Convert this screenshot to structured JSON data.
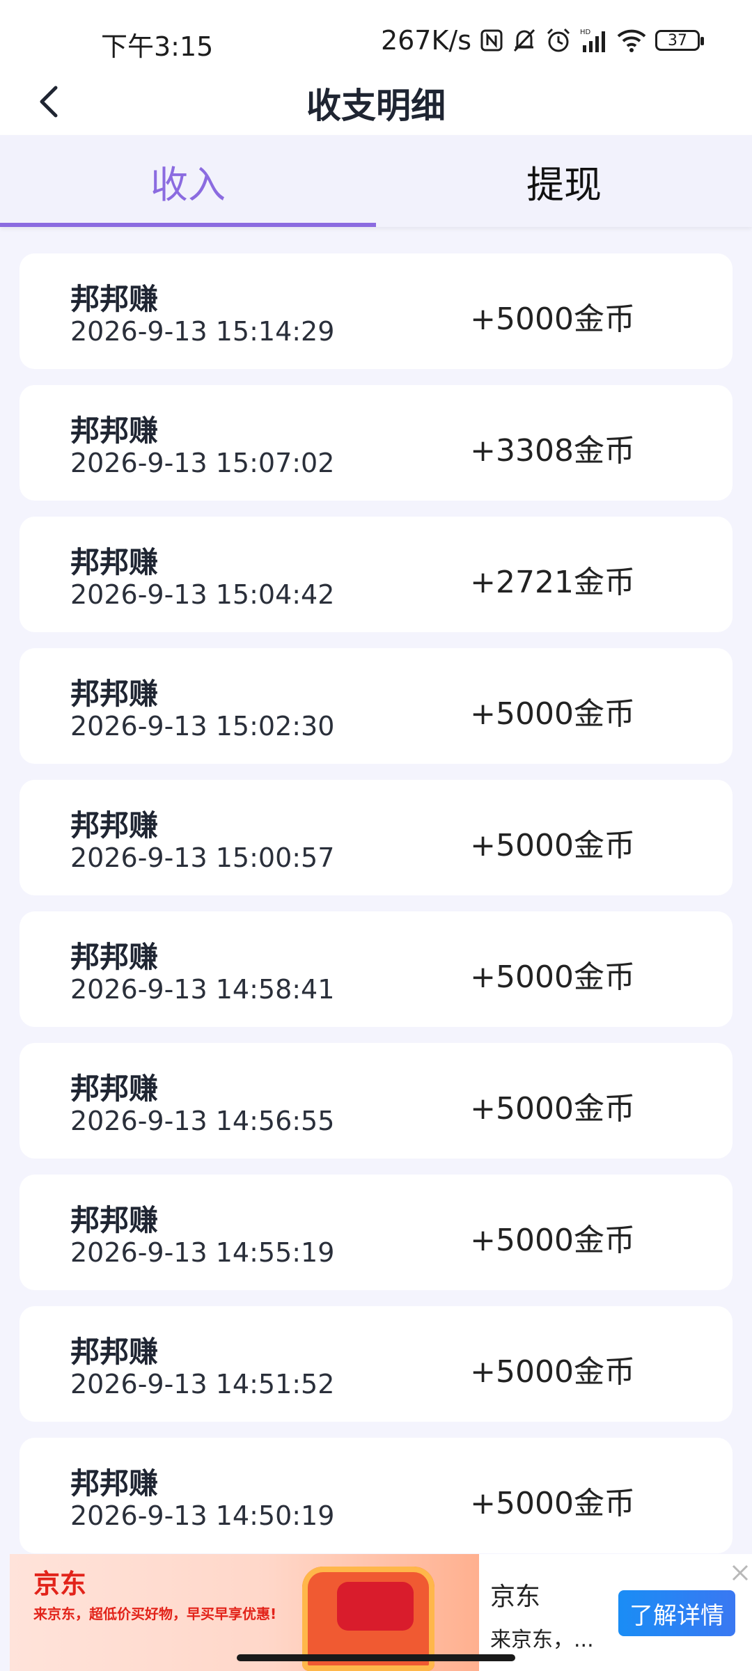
{
  "status_bar": {
    "time": "下午3:15",
    "net_speed": "267K/s",
    "battery": "37",
    "icons": [
      "nfc-icon",
      "bell-muted-icon",
      "alarm-icon",
      "hd-signal-icon",
      "wifi-icon",
      "battery-icon"
    ]
  },
  "header": {
    "title": "收支明细",
    "back_icon": "chevron-left-icon"
  },
  "tabs": [
    {
      "label": "收入",
      "active": true
    },
    {
      "label": "提现",
      "active": false
    }
  ],
  "colors": {
    "accent": "#8b6be0",
    "background": "#f4f4fd",
    "card": "#ffffff",
    "ad_cta": "#1a8df5",
    "ad_red": "#e2231a"
  },
  "records": [
    {
      "name": "邦邦赚",
      "time": "2026-9-13 15:14:29",
      "amount": "+5000金币"
    },
    {
      "name": "邦邦赚",
      "time": "2026-9-13 15:07:02",
      "amount": "+3308金币"
    },
    {
      "name": "邦邦赚",
      "time": "2026-9-13 15:04:42",
      "amount": "+2721金币"
    },
    {
      "name": "邦邦赚",
      "time": "2026-9-13 15:02:30",
      "amount": "+5000金币"
    },
    {
      "name": "邦邦赚",
      "time": "2026-9-13 15:00:57",
      "amount": "+5000金币"
    },
    {
      "name": "邦邦赚",
      "time": "2026-9-13 14:58:41",
      "amount": "+5000金币"
    },
    {
      "name": "邦邦赚",
      "time": "2026-9-13 14:56:55",
      "amount": "+5000金币"
    },
    {
      "name": "邦邦赚",
      "time": "2026-9-13 14:55:19",
      "amount": "+5000金币"
    },
    {
      "name": "邦邦赚",
      "time": "2026-9-13 14:51:52",
      "amount": "+5000金币"
    },
    {
      "name": "邦邦赚",
      "time": "2026-9-13 14:50:19",
      "amount": "+5000金币"
    }
  ],
  "ad": {
    "brand": "京东",
    "slogan": "来京东，超低价买好物，早买早享优惠!",
    "title": "京东",
    "description": "来京东，...",
    "cta_label": "了解详情"
  }
}
